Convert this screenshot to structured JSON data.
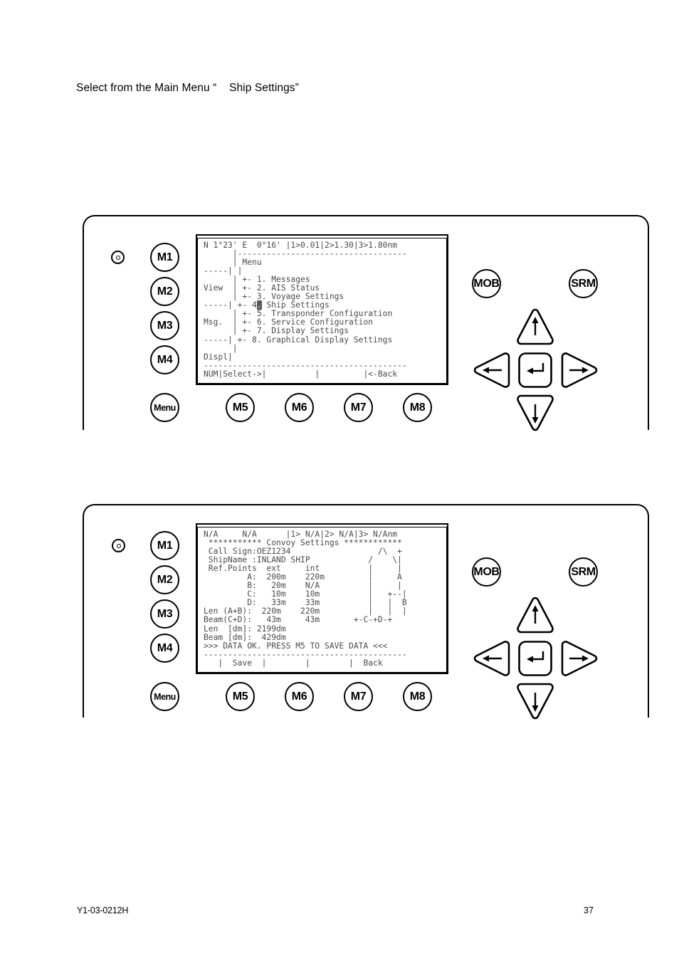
{
  "caption": "Select from the Main Menu “    Ship Settings”",
  "panel_one": {
    "led_name": "power-led",
    "left_keys": [
      "M1",
      "M2",
      "M3",
      "M4"
    ],
    "menu_key": "Menu",
    "bottom_keys": [
      "M5",
      "M6",
      "M7",
      "M8"
    ],
    "right_keys": [
      "MOB",
      "SRM"
    ],
    "nav": {
      "up": "↑",
      "down": "↓",
      "left": "←",
      "right": "→",
      "enter": "↵"
    },
    "lcd": {
      "status_line": "N 1°23' E  0°16' |1>0.01|2>1.30|3>1.80nm",
      "lines": [
        "      |-----------------------------------",
        "      | Menu",
        "-----| |",
        "      | +- 1. Messages",
        "View  | +- 2. AIS Status",
        "      | +- 3. Voyage Settings",
        "-----| +- 4. Ship Settings",
        "      | +- 5. Transponder Configuration",
        "Msg.  | +- 6. Service Configuration",
        "      | +- 7. Display Settings",
        "-----| +- 8. Graphical Display Settings",
        "      |",
        "Displ|",
        "------------------------------------------",
        "NUM|Select->|          |         |<-Back"
      ],
      "highlighted_item": "4",
      "highlight_line_index": 6,
      "highlight_col": 11,
      "softkey_labels": [
        "NUM",
        "Select->",
        "",
        "",
        "<-Back"
      ]
    }
  },
  "panel_two": {
    "led_name": "power-led",
    "left_keys": [
      "M1",
      "M2",
      "M3",
      "M4"
    ],
    "menu_key": "Menu",
    "bottom_keys": [
      "M5",
      "M6",
      "M7",
      "M8"
    ],
    "right_keys": [
      "MOB",
      "SRM"
    ],
    "nav": {
      "up": "↑",
      "down": "↓",
      "left": "←",
      "right": "→",
      "enter": "↵"
    },
    "lcd": {
      "status_line": "N/A     N/A      |1> N/A|2> N/A|3> N/Anm",
      "title": "*********** Convoy Settings ************",
      "call_sign_label": "Call Sign:",
      "call_sign": "OEZ1234",
      "ship_name_label": "ShipName :",
      "ship_name": "INLAND SHIP",
      "ref_points_header": [
        "Ref.Points",
        "ext",
        "int"
      ],
      "ref_points": [
        {
          "id": "A:",
          "ext": "200m",
          "int": "220m"
        },
        {
          "id": "B:",
          "ext": "20m",
          "int": "N/A"
        },
        {
          "id": "C:",
          "ext": "10m",
          "int": "10m"
        },
        {
          "id": "D:",
          "ext": "33m",
          "int": "33m"
        }
      ],
      "len_ab": {
        "label": "Len (A+B):",
        "ext": "220m",
        "int": "220m"
      },
      "beam_cd": {
        "label": "Beam(C+D):",
        "ext": "43m",
        "int": "43m"
      },
      "len_dm": {
        "label": "Len  [dm]:",
        "value": "2199dm"
      },
      "beam_dm": {
        "label": "Beam [dm]:",
        "value": "429dm"
      },
      "status_message": ">>> DATA OK. PRESS M5 TO SAVE DATA <<<",
      "divider": "------------------------------------------",
      "softkey_row": "  | Save  |         |        | Back",
      "softkey_labels": [
        "Save",
        "",
        "",
        "Back"
      ],
      "lines": [
        " *********** Convoy Settings ************",
        " Call Sign:OEZ1234                  /\\  +",
        " ShipName :INLAND SHIP            /    \\|",
        " Ref.Points  ext     int          |     |",
        "         A:  200m    220m         |     A",
        "         B:   20m    N/A          |     |",
        "         C:   10m    10m          |   +--|",
        "         D:   33m    33m          |   |  B",
        "Len (A+B):  220m    220m          |   |  |",
        "Beam(C+D):   43m     43m       +-C-+D-+",
        "Len  [dm]: 2199dm",
        "Beam [dm]:  429dm",
        ">>> DATA OK. PRESS M5 TO SAVE DATA <<<",
        "------------------------------------------",
        "   |  Save  |        |        |  Back"
      ]
    }
  },
  "footer": {
    "doc_id": "Y1-03-0212H",
    "page_number": "37"
  }
}
